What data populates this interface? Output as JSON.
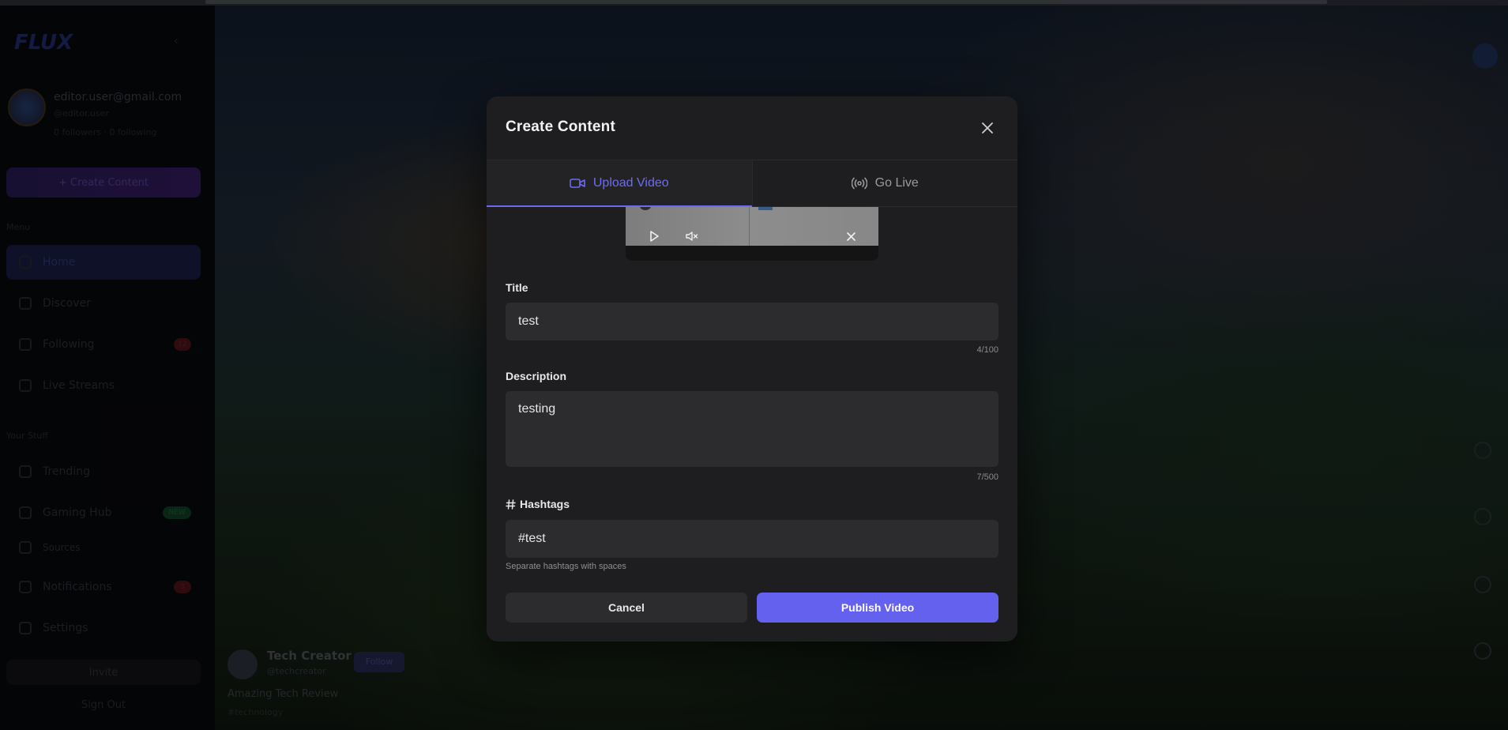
{
  "background": {
    "sidebar": {
      "logo": "FLUX",
      "user_email": "editor.user@gmail.com",
      "user_handle": "@editor.user",
      "user_stats": "0 followers · 0 following",
      "create_button": "+ Create Content",
      "section_menu": "Menu",
      "nav_items": [
        {
          "label": "Home",
          "active": true
        },
        {
          "label": "Discover"
        },
        {
          "label": "Following",
          "badge": "12"
        },
        {
          "label": "Live Streams"
        }
      ],
      "section_you": "Your Stuff",
      "nav_items_2": [
        {
          "label": "Trending"
        },
        {
          "label": "Gaming Hub",
          "badge": "NEW"
        },
        {
          "label": "Sources"
        },
        {
          "label": "Notifications",
          "badge": "3"
        },
        {
          "label": "Settings"
        }
      ],
      "bottom_button": "Invite",
      "bottom_link": "Sign Out"
    },
    "feed": {
      "creator_name": "Tech Creator",
      "creator_handle": "@techcreator",
      "follow_label": "Follow",
      "video_title": "Amazing Tech Review",
      "video_tag": "#technology"
    }
  },
  "modal": {
    "title": "Create Content",
    "tabs": [
      {
        "label": "Upload Video",
        "icon": "video-camera-icon",
        "active": true
      },
      {
        "label": "Go Live",
        "icon": "broadcast-icon",
        "active": false
      }
    ],
    "title_field": {
      "label": "Title",
      "value": "test",
      "counter": "4/100"
    },
    "description_field": {
      "label": "Description",
      "value": "testing",
      "counter": "7/500"
    },
    "hashtags_field": {
      "label": "Hashtags",
      "value": "#test",
      "hint": "Separate hashtags with spaces"
    },
    "cancel_label": "Cancel",
    "publish_label": "Publish Video"
  },
  "colors": {
    "accent": "#6461ee",
    "modal_bg": "#1e1e20",
    "field_bg": "#2c2c2f"
  }
}
